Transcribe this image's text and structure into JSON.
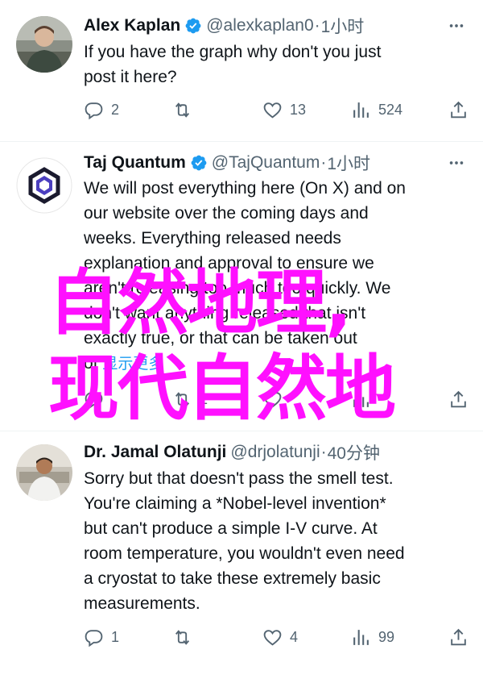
{
  "tweets": [
    {
      "name": "Alex Kaplan",
      "handle": "@alexkaplan0",
      "separator": "·",
      "time": "1小时",
      "text": "If you have the graph why don't you just\npost it here?",
      "translation_label": "",
      "replies": "2",
      "retweets": "",
      "likes": "13",
      "views": "524"
    },
    {
      "name": "Taj Quantum",
      "handle": "@TajQuantum",
      "separator": "·",
      "time": "1小时",
      "text": "We will post everything here (On X) and on\nour website over the coming days and\nweeks. Everything released needs\nexplanation and approval to ensure we\naren't releasing too much too quickly. We\ndon't want anything released that isn't\nexactly true, or that can be taken out\nof ",
      "translation_label": "显示更多",
      "replies": "",
      "retweets": "1",
      "likes": "",
      "views": ""
    },
    {
      "name": "Dr. Jamal Olatunji",
      "handle": "@drjolatunji",
      "separator": "·",
      "time": "40分钟",
      "text": "Sorry but that doesn't pass the smell test.\nYou're claiming a *Nobel-level invention*\nbut can't produce a simple I-V curve. At\nroom temperature, you wouldn't even need\na cryostat to take these extremely basic\nmeasurements.",
      "translation_label": "",
      "replies": "1",
      "retweets": "",
      "likes": "4",
      "views": "99"
    }
  ],
  "overlay": {
    "line1": "自然地理,",
    "line2": "现代自然地"
  },
  "colors": {
    "verified": "#1d9bf0",
    "secondary_text": "#536471",
    "overlay": "#ff10ff"
  },
  "icons": [
    "verified-badge-icon",
    "more-icon",
    "reply-icon",
    "retweet-icon",
    "like-icon",
    "views-icon",
    "share-icon"
  ]
}
